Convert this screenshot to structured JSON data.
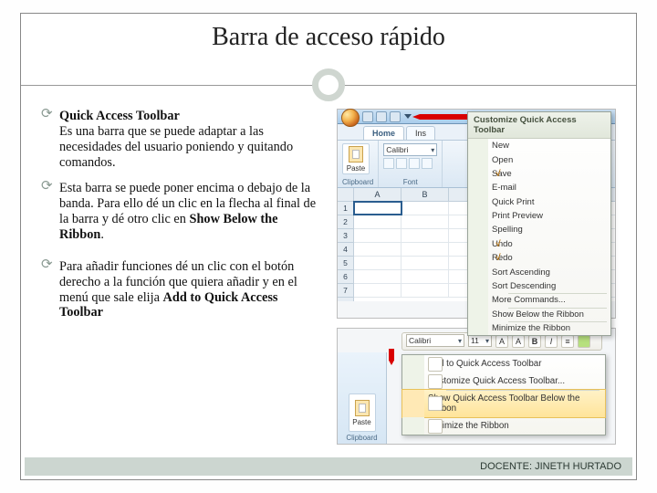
{
  "title": "Barra de acceso rápido",
  "bullets": {
    "b1_title": "Quick Access Toolbar",
    "b1_body_a": "Es una barra que se puede adaptar a las necesidades del usuario poniendo y quitando comandos.",
    "b2_body_a": "Esta barra se puede poner encima o debajo de la banda. Para ello dé un clic en la flecha al final de la barra y dé otro clic en ",
    "b2_bold": "Show Below the Ribbon",
    "b2_tail": ".",
    "b3_body_a": "Para añadir funciones dé un clic con el botón derecho a la función que quiera añadir y en el menú que sale elija ",
    "b3_bold": "Add to Quick Access Toolbar"
  },
  "s1": {
    "tabs": {
      "home": "Home",
      "insert": "Ins"
    },
    "ribbon": {
      "paste": "Paste",
      "clipboard_lbl": "Clipboard",
      "font_name": "Calibri",
      "font_lbl": "Font"
    },
    "cols": [
      "",
      "A",
      "B"
    ],
    "rows": [
      "1",
      "2",
      "3",
      "4",
      "5",
      "6",
      "7"
    ],
    "menu": {
      "header": "Customize Quick Access Toolbar",
      "items": [
        {
          "label": "New",
          "checked": false
        },
        {
          "label": "Open",
          "checked": false
        },
        {
          "label": "Save",
          "checked": true
        },
        {
          "label": "E-mail",
          "checked": false
        },
        {
          "label": "Quick Print",
          "checked": false
        },
        {
          "label": "Print Preview",
          "checked": false
        },
        {
          "label": "Spelling",
          "checked": false
        },
        {
          "label": "Undo",
          "checked": true
        },
        {
          "label": "Redo",
          "checked": true
        },
        {
          "label": "Sort Ascending",
          "checked": false
        },
        {
          "label": "Sort Descending",
          "checked": false
        },
        {
          "label": "More Commands...",
          "checked": false,
          "sep": true
        },
        {
          "label": "Show Below the Ribbon",
          "checked": false,
          "sep": true
        },
        {
          "label": "Minimize the Ribbon",
          "checked": false,
          "sep": true
        }
      ]
    }
  },
  "s2": {
    "mini": {
      "font": "Calibri",
      "size": "11"
    },
    "left": {
      "paste": "Paste",
      "clipboard": "Clipboard"
    },
    "ctx": [
      {
        "label": "Add to Quick Access Toolbar",
        "hi": false
      },
      {
        "label": "Customize Quick Access Toolbar...",
        "hi": false
      },
      {
        "label": "Show Quick Access Toolbar Below the Ribbon",
        "hi": true,
        "sep": true
      },
      {
        "label": "Minimize the Ribbon",
        "hi": false
      }
    ]
  },
  "footer": "DOCENTE: JINETH HURTADO"
}
